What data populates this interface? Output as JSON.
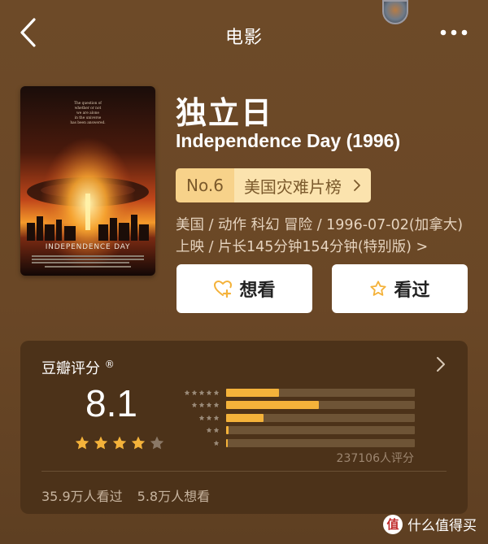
{
  "header": {
    "title": "电影"
  },
  "movie": {
    "title_cn": "独立日",
    "title_en": "Independence Day (1996)",
    "rank": {
      "number": "No.6",
      "list_name": "美国灾难片榜"
    },
    "meta_line1": "美国 / 动作 科幻 冒险 / 1996-07-02(加拿大)",
    "meta_line2": "上映 / 片长145分钟154分钟(特别版) >",
    "poster": {
      "tagline_lines": [
        "The question of",
        "whether or not",
        "we are alone",
        "in the universe",
        "has been answered."
      ],
      "logo_text": "INDEPENDENCE DAY"
    }
  },
  "actions": {
    "want_label": "想看",
    "seen_label": "看过"
  },
  "rating": {
    "title": "豆瓣评分",
    "registered_mark": "®",
    "score": "8.1",
    "stars_filled": 4,
    "stars_total": 5,
    "distribution": [
      {
        "stars": 5,
        "fraction": 0.28
      },
      {
        "stars": 4,
        "fraction": 0.49
      },
      {
        "stars": 3,
        "fraction": 0.2
      },
      {
        "stars": 2,
        "fraction": 0.015
      },
      {
        "stars": 1,
        "fraction": 0.004
      }
    ],
    "count": "237106人评分",
    "watched": "35.9万人看过",
    "wanted": "5.8万人想看"
  },
  "watermark": {
    "logo": "值",
    "text": "什么值得买"
  },
  "colors": {
    "accent_star": "#f4b23a",
    "background": "#6d4a28",
    "card": "#4c3219"
  }
}
